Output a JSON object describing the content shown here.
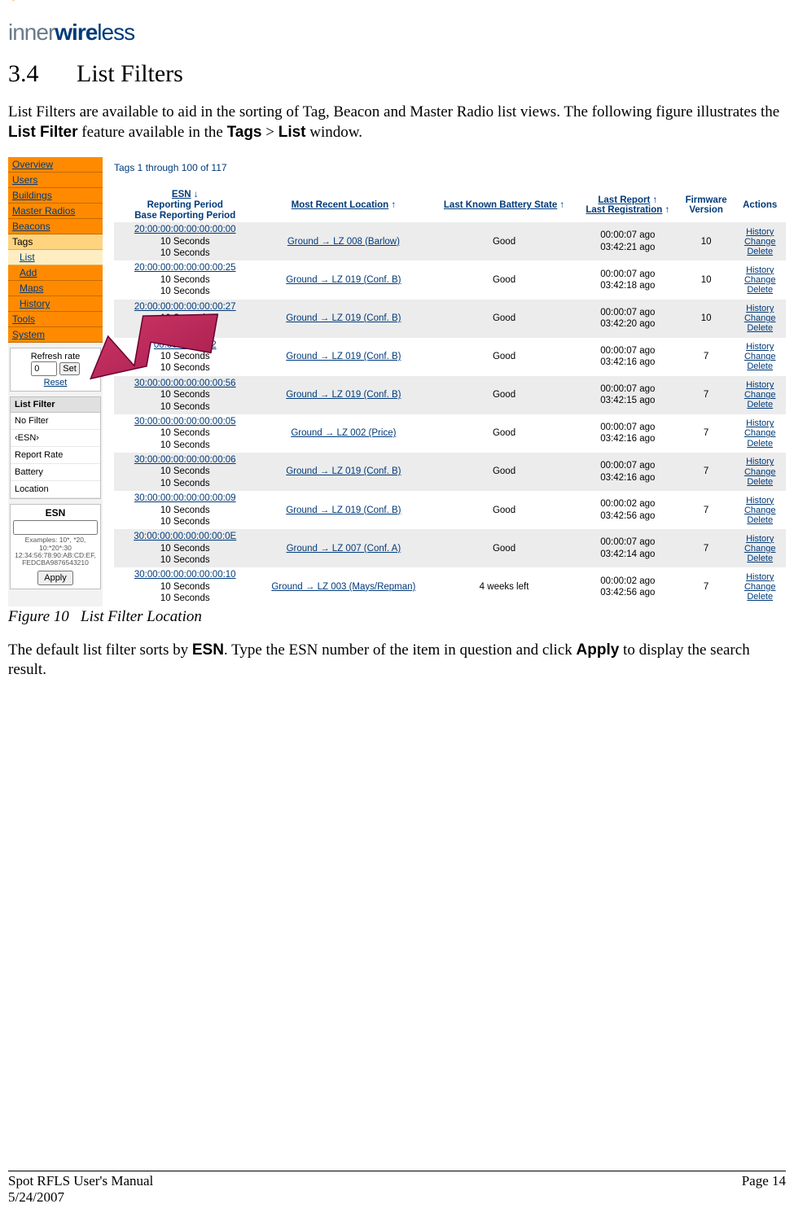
{
  "logo": {
    "part1": "inner",
    "part2": "wire",
    "part3": "less"
  },
  "section": {
    "number": "3.4",
    "title": "List Filters"
  },
  "intro": {
    "line1": "List Filters are available to aid in the sorting of Tag, Beacon and Master Radio list views. The following figure illustrates the ",
    "bold1": "List Filter",
    "mid1": " feature available in the ",
    "bold2": "Tags",
    "mid2": " > ",
    "bold3": "List",
    "end": " window."
  },
  "sidebar": {
    "items": [
      {
        "label": "Overview",
        "cls": "side-primary"
      },
      {
        "label": "Users",
        "cls": "side-primary"
      },
      {
        "label": "Buildings",
        "cls": "side-primary"
      },
      {
        "label": "Master Radios",
        "cls": "side-primary"
      },
      {
        "label": "Beacons",
        "cls": "side-primary"
      },
      {
        "label": "Tags",
        "cls": "side-active"
      },
      {
        "label": "List",
        "cls": "side-active2 side-sub"
      },
      {
        "label": "Add",
        "cls": "side-primary side-sub"
      },
      {
        "label": "Maps",
        "cls": "side-primary side-sub"
      },
      {
        "label": "History",
        "cls": "side-primary side-sub"
      },
      {
        "label": "Tools",
        "cls": "side-primary"
      },
      {
        "label": "System",
        "cls": "side-primary"
      }
    ],
    "refresh": {
      "label": "Refresh rate",
      "value": "0",
      "set": "Set",
      "reset": "Reset"
    },
    "filter": {
      "header": "List Filter",
      "rows": [
        "No Filter",
        "‹ESN›",
        "Report Rate",
        "Battery",
        "Location"
      ]
    },
    "esn": {
      "label": "ESN",
      "examples": "Examples: 10*, *20, 10:*20*:30 12:34:56:78:90:AB:CD:EF, FEDCBA9876543210",
      "apply": "Apply"
    }
  },
  "count": "Tags 1 through 100 of 117",
  "columns": {
    "c1a": "ESN",
    "c1b": "Reporting Period",
    "c1c": "Base Reporting Period",
    "c2": "Most Recent Location",
    "c3": "Last Known Battery State",
    "c4a": "Last Report",
    "c4b": "Last Registration",
    "c5": "Firmware Version",
    "c6": "Actions"
  },
  "actions": {
    "a": "History",
    "b": "Change",
    "c": "Delete"
  },
  "rows": [
    {
      "esn": "20:00:00:00:00:00:00:00",
      "rp": "10 Seconds",
      "brp": "10 Seconds",
      "loc": "Ground → LZ 008 (Barlow)",
      "bat": "Good",
      "lr": "00:00:07 ago",
      "lreg": "03:42:21 ago",
      "fw": "10"
    },
    {
      "esn": "20:00:00:00:00:00:00:25",
      "rp": "10 Seconds",
      "brp": "10 Seconds",
      "loc": "Ground → LZ 019 (Conf. B)",
      "bat": "Good",
      "lr": "00:00:07 ago",
      "lreg": "03:42:18 ago",
      "fw": "10"
    },
    {
      "esn": "20:00:00:00:00:00:00:27",
      "rp": "10 Seconds",
      "brp": "10 Seconds",
      "loc": "Ground → LZ 019 (Conf. B)",
      "bat": "Good",
      "lr": "00:00:07 ago",
      "lreg": "03:42:20 ago",
      "fw": "10"
    },
    {
      "esn": "",
      "rp": "10 Seconds",
      "brp": "10 Seconds",
      "loc": "Ground → LZ 019 (Conf. B)",
      "bat": "Good",
      "lr": "00:00:07 ago",
      "lreg": "03:42:16 ago",
      "fw": "7",
      "partial_esn": "00:00:00:00:52"
    },
    {
      "esn": "30:00:00:00:00:00:00:56",
      "rp": "10 Seconds",
      "brp": "10 Seconds",
      "loc": "Ground → LZ 019 (Conf. B)",
      "bat": "Good",
      "lr": "00:00:07 ago",
      "lreg": "03:42:15 ago",
      "fw": "7"
    },
    {
      "esn": "30:00:00:00:00:00:00:05",
      "rp": "10 Seconds",
      "brp": "10 Seconds",
      "loc": "Ground → LZ 002 (Price)",
      "bat": "Good",
      "lr": "00:00:07 ago",
      "lreg": "03:42:16 ago",
      "fw": "7"
    },
    {
      "esn": "30:00:00:00:00:00:00:06",
      "rp": "10 Seconds",
      "brp": "10 Seconds",
      "loc": "Ground → LZ 019 (Conf. B)",
      "bat": "Good",
      "lr": "00:00:07 ago",
      "lreg": "03:42:16 ago",
      "fw": "7"
    },
    {
      "esn": "30:00:00:00:00:00:00:09",
      "rp": "10 Seconds",
      "brp": "10 Seconds",
      "loc": "Ground → LZ 019 (Conf. B)",
      "bat": "Good",
      "lr": "00:00:02 ago",
      "lreg": "03:42:56 ago",
      "fw": "7"
    },
    {
      "esn": "30:00:00:00:00:00:00:0E",
      "rp": "10 Seconds",
      "brp": "10 Seconds",
      "loc": "Ground → LZ 007 (Conf. A)",
      "bat": "Good",
      "lr": "00:00:07 ago",
      "lreg": "03:42:14 ago",
      "fw": "7"
    },
    {
      "esn": "30:00:00:00:00:00:00:10",
      "rp": "10 Seconds",
      "brp": "10 Seconds",
      "loc": "Ground → LZ 003 (Mays/Repman)",
      "bat": "4 weeks left",
      "lr": "00:00:02 ago",
      "lreg": "03:42:56 ago",
      "fw": "7"
    }
  ],
  "figcaption": {
    "num": "Figure 10",
    "text": "List Filter Location"
  },
  "para2": {
    "p1": "The default list filter sorts by ",
    "b1": "ESN",
    "p2": ".  Type the ESN number of the item in question and click ",
    "b2": "Apply",
    "p3": " to display the search result."
  },
  "footer": {
    "left1": "Spot RFLS User's Manual",
    "left2": "5/24/2007",
    "right": "Page 14"
  }
}
